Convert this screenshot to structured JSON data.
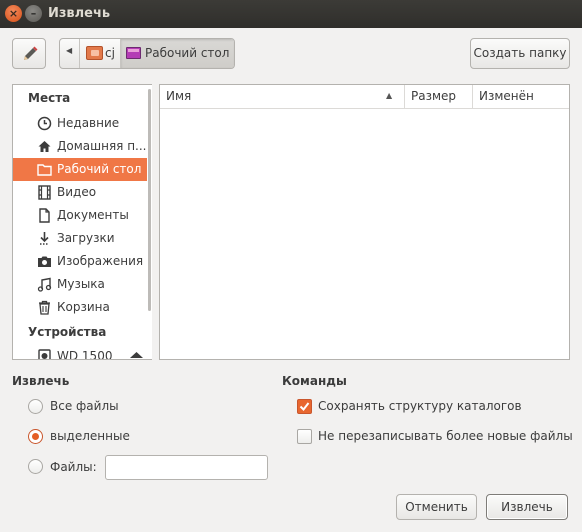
{
  "window": {
    "title": "Извлечь"
  },
  "toolbar": {
    "path": [
      "cj",
      "Рабочий стол"
    ],
    "create_folder_label": "Создать папку"
  },
  "sidebar": {
    "places_heading": "Места",
    "items": [
      {
        "label": "Недавние",
        "icon": "clock-icon"
      },
      {
        "label": "Домашняя п...",
        "icon": "home-icon"
      },
      {
        "label": "Рабочий стол",
        "icon": "folder-icon",
        "selected": true
      },
      {
        "label": "Видео",
        "icon": "film-icon"
      },
      {
        "label": "Документы",
        "icon": "document-icon"
      },
      {
        "label": "Загрузки",
        "icon": "download-icon"
      },
      {
        "label": "Изображения",
        "icon": "camera-icon"
      },
      {
        "label": "Музыка",
        "icon": "music-icon"
      },
      {
        "label": "Корзина",
        "icon": "trash-icon"
      }
    ],
    "devices_heading": "Устройства",
    "devices": [
      {
        "label": "WD 1500",
        "icon": "drive-icon"
      }
    ]
  },
  "filelist": {
    "columns": [
      "Имя",
      "Размер",
      "Изменён"
    ],
    "sort_column": "Имя",
    "sort_direction": "ascending",
    "rows": []
  },
  "extract": {
    "heading": "Извлечь",
    "options": [
      {
        "label": "Все файлы",
        "checked": false
      },
      {
        "label": "выделенные",
        "checked": true
      },
      {
        "label": "Файлы:",
        "checked": false
      }
    ],
    "files_value": ""
  },
  "commands": {
    "heading": "Команды",
    "options": [
      {
        "label": "Сохранять структуру каталогов",
        "checked": true
      },
      {
        "label": "Не перезаписывать более новые файлы",
        "checked": false
      }
    ]
  },
  "buttons": {
    "cancel": "Отменить",
    "extract": "Извлечь"
  },
  "colors": {
    "accent": "#f07746",
    "titlebar": "#3c3b37",
    "close_button": "#e45e25"
  }
}
